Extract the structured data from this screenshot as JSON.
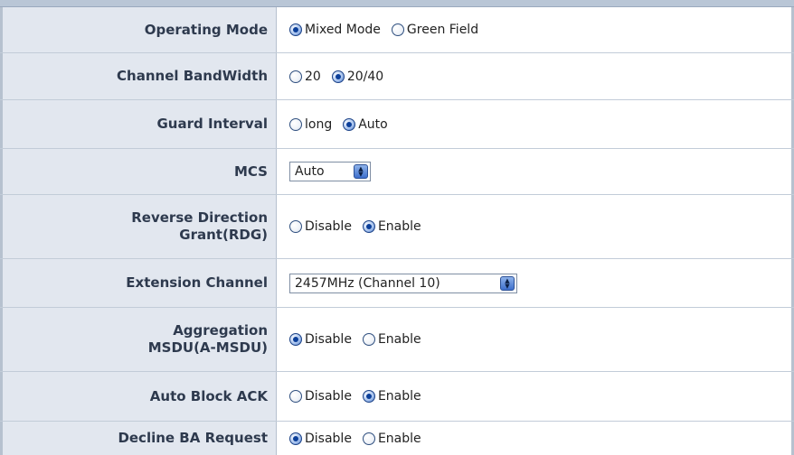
{
  "rows": [
    {
      "label": "Operating Mode",
      "options": [
        {
          "label": "Mixed Mode",
          "selected": true
        },
        {
          "label": "Green Field",
          "selected": false
        }
      ]
    },
    {
      "label": "Channel BandWidth",
      "options": [
        {
          "label": "20",
          "selected": false
        },
        {
          "label": "20/40",
          "selected": true
        }
      ]
    },
    {
      "label": "Guard Interval",
      "options": [
        {
          "label": "long",
          "selected": false
        },
        {
          "label": "Auto",
          "selected": true
        }
      ]
    },
    {
      "label": "MCS",
      "select_value": "Auto"
    },
    {
      "label_line1": "Reverse Direction",
      "label_line2": "Grant(RDG)",
      "options": [
        {
          "label": "Disable",
          "selected": false
        },
        {
          "label": "Enable",
          "selected": true
        }
      ]
    },
    {
      "label": "Extension Channel",
      "select_value": "2457MHz (Channel 10)"
    },
    {
      "label_line1": "Aggregation",
      "label_line2": "MSDU(A-MSDU)",
      "options": [
        {
          "label": "Disable",
          "selected": true
        },
        {
          "label": "Enable",
          "selected": false
        }
      ]
    },
    {
      "label": "Auto Block ACK",
      "options": [
        {
          "label": "Disable",
          "selected": false
        },
        {
          "label": "Enable",
          "selected": true
        }
      ]
    },
    {
      "label": "Decline BA Request",
      "options": [
        {
          "label": "Disable",
          "selected": true
        },
        {
          "label": "Enable",
          "selected": false
        }
      ]
    }
  ],
  "colors": {
    "label_bg": "#e2e7ef",
    "border": "#b6c1cf",
    "label_text": "#2e3a4e",
    "radio_selected": "#0b3f9a"
  }
}
